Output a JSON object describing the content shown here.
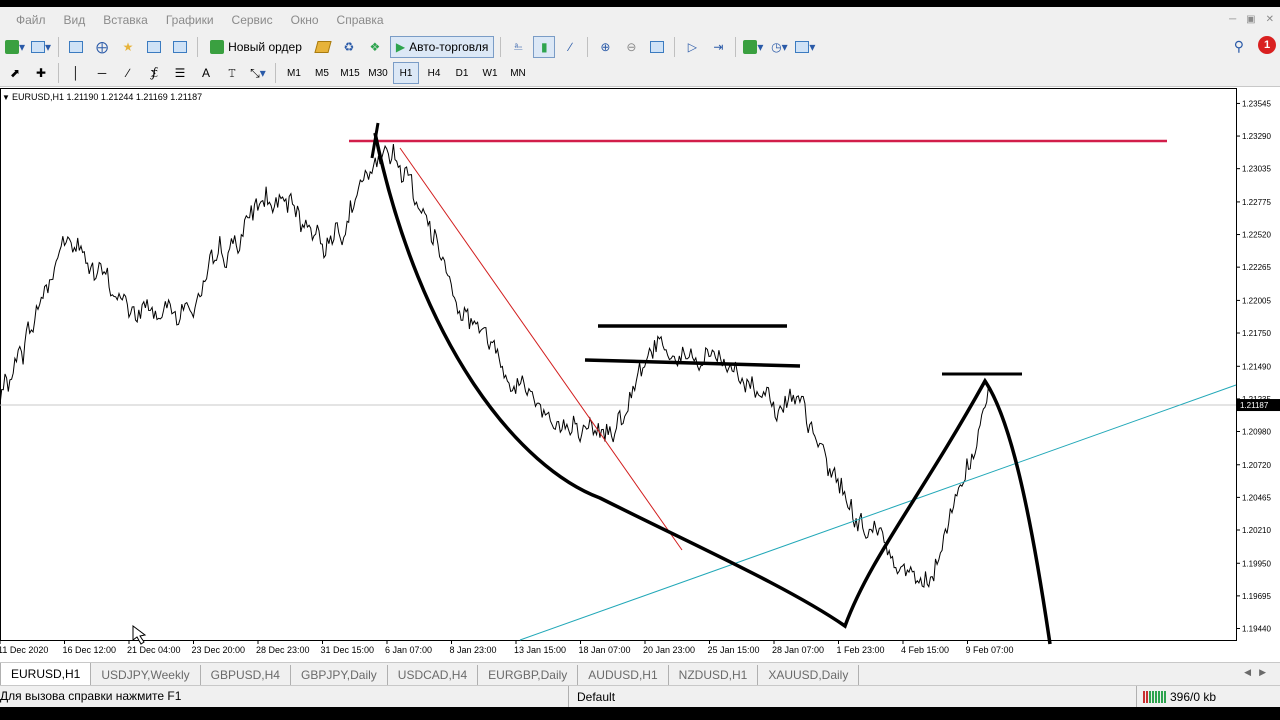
{
  "menu": {
    "items": [
      "Файл",
      "Вид",
      "Вставка",
      "Графики",
      "Сервис",
      "Окно",
      "Справка"
    ]
  },
  "toolbar": {
    "new_order_label": "Новый ордер",
    "autotrading_label": "Авто-торговля"
  },
  "timeframes": [
    "M1",
    "M5",
    "M15",
    "M30",
    "H1",
    "H4",
    "D1",
    "W1",
    "MN"
  ],
  "active_timeframe": "H1",
  "notification_count": "1",
  "chart": {
    "title": "EURUSD,H1  1.21190 1.21244 1.21169 1.21187",
    "current_price_label": "1.21187",
    "price_ticks": [
      "1.23545",
      "1.23290",
      "1.23035",
      "1.22775",
      "1.22520",
      "1.22265",
      "1.22005",
      "1.21750",
      "1.21490",
      "1.21235",
      "1.20980",
      "1.20720",
      "1.20465",
      "1.20210",
      "1.19950",
      "1.19695",
      "1.19440"
    ],
    "time_ticks": [
      "11 Dec 2020",
      "16 Dec 12:00",
      "21 Dec 04:00",
      "23 Dec 20:00",
      "28 Dec 23:00",
      "31 Dec 15:00",
      "6 Jan 07:00",
      "8 Jan 23:00",
      "13 Jan 15:00",
      "18 Jan 07:00",
      "20 Jan 23:00",
      "25 Jan 15:00",
      "28 Jan 07:00",
      "1 Feb 23:00",
      "4 Feb 15:00",
      "9 Feb 07:00"
    ],
    "colors": {
      "price_line": "#000000",
      "resistance_line": "#d21e4a",
      "trend_line": "#d21e1e",
      "channel_line": "#22a8b8",
      "drawing": "#000000"
    }
  },
  "chart_data": {
    "type": "line",
    "title": "EURUSD,H1  1.21190 1.21244 1.21169 1.21187",
    "xlabel": "",
    "ylabel": "",
    "ylim": [
      1.1935,
      1.2365
    ],
    "x": [
      "11 Dec 2020",
      "16 Dec 12:00",
      "21 Dec 04:00",
      "23 Dec 20:00",
      "28 Dec 23:00",
      "31 Dec 15:00",
      "6 Jan 07:00",
      "8 Jan 23:00",
      "13 Jan 15:00",
      "18 Jan 07:00",
      "20 Jan 23:00",
      "25 Jan 15:00",
      "28 Jan 07:00",
      "1 Feb 23:00",
      "4 Feb 15:00",
      "9 Feb 07:00"
    ],
    "series": [
      {
        "values": [
          1.212,
          1.225,
          1.219,
          1.22,
          1.228,
          1.225,
          1.232,
          1.22,
          1.213,
          1.208,
          1.217,
          1.215,
          1.212,
          1.203,
          1.198,
          1.212
        ]
      }
    ],
    "grid": false,
    "current_price": 1.21187
  },
  "tabs": [
    "EURUSD,H1",
    "USDJPY,Weekly",
    "GBPUSD,H4",
    "GBPJPY,Daily",
    "USDCAD,H4",
    "EURGBP,Daily",
    "AUDUSD,H1",
    "NZDUSD,H1",
    "XAUUSD,Daily"
  ],
  "status": {
    "help_text": "Для вызова справки нажмите F1",
    "profile": "Default",
    "traffic": "396/0 kb"
  }
}
